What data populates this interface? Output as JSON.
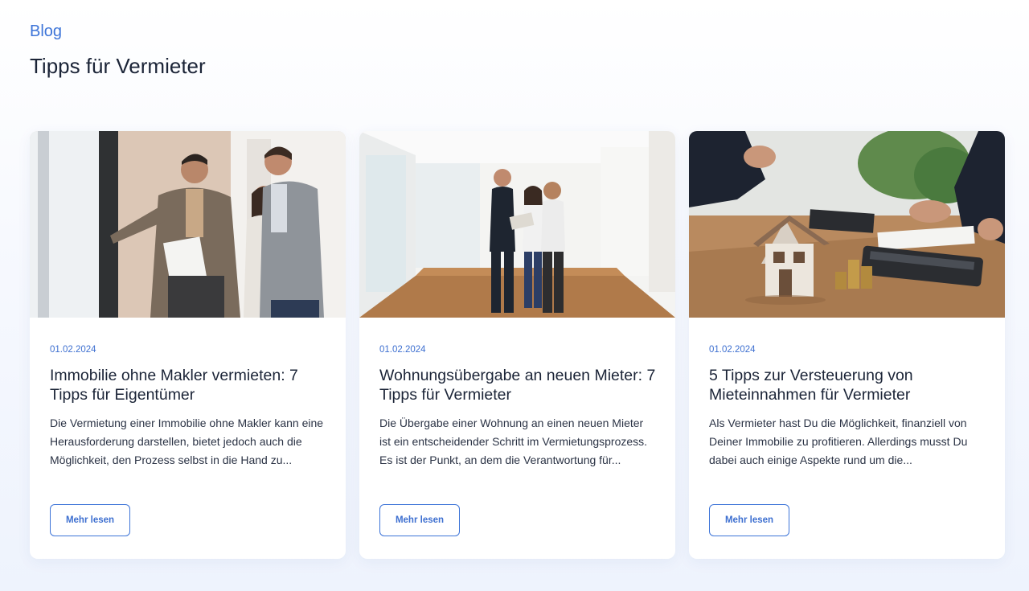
{
  "header": {
    "eyebrow": "Blog",
    "title": "Tipps für Vermieter"
  },
  "colors": {
    "accent": "#3d74d8",
    "text": "#1b2437",
    "background": "#f3f6fd"
  },
  "cards": [
    {
      "image": "landlord-showing-apartment-photo",
      "date": "01.02.2024",
      "title": "Immobilie ohne Makler vermieten: 7 Tipps für Eigentümer",
      "excerpt": "Die Vermietung einer Immobilie ohne Makler kann eine Herausforderung darstellen, bietet jedoch auch die Möglichkeit, den Prozess selbst in die Hand zu...",
      "button_label": "Mehr lesen"
    },
    {
      "image": "apartment-handover-photo",
      "date": "01.02.2024",
      "title": "Wohnungsübergabe an neuen Mieter: 7 Tipps für Vermieter",
      "excerpt": "Die Übergabe einer Wohnung an einen neuen Mieter ist ein entscheidender Schritt im Vermietungsprozess. Es ist der Punkt, an dem die Verantwortung für...",
      "button_label": "Mehr lesen"
    },
    {
      "image": "house-model-coins-calculator-photo",
      "date": "01.02.2024",
      "title": "5 Tipps zur Versteuerung von Mieteinnahmen für Vermieter",
      "excerpt": "Als Vermieter hast Du die Möglichkeit, finanziell von Deiner Immobilie zu profitieren. Allerdings musst Du dabei auch einige Aspekte rund um die...",
      "button_label": "Mehr lesen"
    }
  ]
}
